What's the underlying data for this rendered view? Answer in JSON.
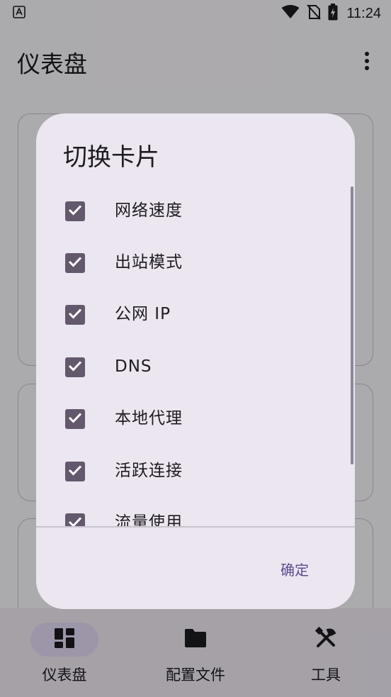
{
  "status_bar": {
    "time": "11:24",
    "icons": [
      "notification-a-icon",
      "wifi-icon",
      "no-sim-icon",
      "battery-charging-icon"
    ]
  },
  "app_bar": {
    "title": "仪表盘",
    "overflow_icon": "more-vert-icon"
  },
  "dialog": {
    "title": "切换卡片",
    "items": [
      {
        "label": "网络速度",
        "checked": true
      },
      {
        "label": "出站模式",
        "checked": true
      },
      {
        "label": "公网 IP",
        "checked": true
      },
      {
        "label": "DNS",
        "checked": true
      },
      {
        "label": "本地代理",
        "checked": true
      },
      {
        "label": "活跃连接",
        "checked": true
      },
      {
        "label": "流量使用",
        "checked": true
      }
    ],
    "confirm_label": "确定"
  },
  "bottom_nav": {
    "items": [
      {
        "label": "仪表盘",
        "icon": "dashboard-icon",
        "active": true
      },
      {
        "label": "配置文件",
        "icon": "folder-icon",
        "active": false
      },
      {
        "label": "工具",
        "icon": "tools-icon",
        "active": false
      }
    ]
  },
  "colors": {
    "accent": "#64586d",
    "dialog_bg": "#ece6f0",
    "nav_active": "#e8def8",
    "button_text": "#5a4b8f"
  }
}
